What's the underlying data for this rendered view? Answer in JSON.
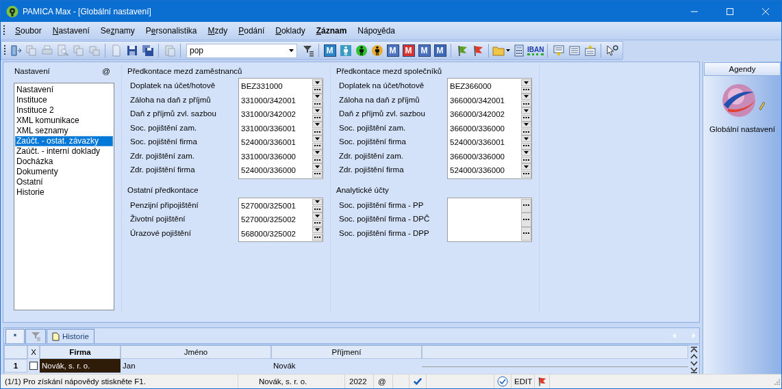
{
  "window": {
    "title": "PAMICA Max - [Globální nastavení]"
  },
  "menu": [
    {
      "key": "S",
      "post": "oubor",
      "active": false
    },
    {
      "key": "N",
      "post": "astavení",
      "active": false
    },
    {
      "pre": "Se",
      "key": "z",
      "post": "namy",
      "active": false
    },
    {
      "pre": "P",
      "key": "e",
      "post": "rsonalistika",
      "active": false
    },
    {
      "key": "M",
      "post": "zdy",
      "active": false
    },
    {
      "key": "P",
      "post": "odání",
      "active": false
    },
    {
      "key": "D",
      "post": "oklady",
      "active": false
    },
    {
      "key": "Z",
      "post": "áznam",
      "active": true
    },
    {
      "pre": "Nápo",
      "key": "v",
      "post": "ěda",
      "active": false
    }
  ],
  "toolbar": {
    "groups": [
      [
        {
          "kind": "door",
          "disabled": false
        },
        {
          "kind": "pages",
          "disabled": true
        },
        {
          "kind": "printer",
          "disabled": true
        },
        {
          "kind": "preview",
          "disabled": true
        },
        {
          "kind": "pages",
          "disabled": true
        },
        {
          "kind": "stack",
          "disabled": true
        }
      ],
      [
        {
          "kind": "page",
          "disabled": true
        },
        {
          "kind": "floppy",
          "disabled": false
        },
        {
          "kind": "floppies",
          "disabled": false
        }
      ],
      [
        {
          "kind": "clipboard",
          "disabled": true
        }
      ],
      [
        {
          "kind": "combo",
          "value": "pop",
          "disabled": false
        },
        {
          "kind": "filter",
          "disabled": false
        }
      ],
      [
        {
          "kind": "tile",
          "text": "M",
          "color": "#2a86c8",
          "disabled": false
        },
        {
          "kind": "person-tile",
          "color": "#3a9cc4",
          "disabled": false
        },
        {
          "kind": "person-circle",
          "color": "#2fc22f",
          "disabled": false
        },
        {
          "kind": "person-circle",
          "color": "#e8ac2c",
          "disabled": false
        },
        {
          "kind": "tile",
          "text": "M",
          "color": "#4e76c2",
          "disabled": false
        },
        {
          "kind": "tile",
          "text": "M",
          "color": "#d83434",
          "disabled": false
        },
        {
          "kind": "tile",
          "text": "M",
          "color": "#4a72c0",
          "disabled": false
        },
        {
          "kind": "tile",
          "text": "M",
          "color": "#3e68b8",
          "disabled": false
        }
      ],
      [
        {
          "kind": "flag",
          "color": "#5e9e22",
          "disabled": false
        },
        {
          "kind": "flag",
          "color": "#e03a28",
          "disabled": false
        }
      ],
      [
        {
          "kind": "folder",
          "disabled": false
        },
        {
          "kind": "calculator",
          "disabled": false
        },
        {
          "kind": "iban",
          "text": "IBAN",
          "disabled": false
        }
      ],
      [
        {
          "kind": "list-down",
          "disabled": false
        },
        {
          "kind": "list",
          "disabled": false
        },
        {
          "kind": "list-up",
          "disabled": false
        }
      ],
      [
        {
          "kind": "help",
          "disabled": false
        }
      ]
    ]
  },
  "settings": {
    "title": "Nastavení",
    "at": "@",
    "items": [
      {
        "label": "Nastavení",
        "selected": false
      },
      {
        "label": "Instituce",
        "selected": false
      },
      {
        "label": "Instituce 2",
        "selected": false
      },
      {
        "label": "XML komunikace",
        "selected": false
      },
      {
        "label": "XML seznamy",
        "selected": false
      },
      {
        "label": "Zaúčt. - ostat. závazky",
        "selected": true
      },
      {
        "label": "Zaúčt. - interní doklady",
        "selected": false
      },
      {
        "label": "Docházka",
        "selected": false
      },
      {
        "label": "Dokumenty",
        "selected": false
      },
      {
        "label": "Ostatní",
        "selected": false
      },
      {
        "label": "Historie",
        "selected": false
      }
    ]
  },
  "columns": [
    [
      {
        "title": "Předkontace mezd zaměstnanců",
        "rows": [
          {
            "label": "Doplatek na účet/hotově",
            "value": "BEZ331000",
            "kind": "combo"
          },
          {
            "label": "Záloha na daň z příjmů",
            "value": "331000/342001",
            "kind": "combo"
          },
          {
            "label": "Daň z příjmů zvl. sazbou",
            "value": "331000/342002",
            "kind": "combo"
          },
          {
            "label": "Soc. pojištění zam.",
            "value": "331000/336001",
            "kind": "combo"
          },
          {
            "label": "Soc. pojištění firma",
            "value": "524000/336001",
            "kind": "combo"
          },
          {
            "label": "Zdr. pojištění zam.",
            "value": "331000/336000",
            "kind": "combo"
          },
          {
            "label": "Zdr. pojištění firma",
            "value": "524000/336000",
            "kind": "combo"
          }
        ]
      },
      {
        "title": "Ostatní předkontace",
        "rows": [
          {
            "label": "Penzijní připojištění",
            "value": "527000/325001",
            "kind": "combo"
          },
          {
            "label": "Životní pojištění",
            "value": "527000/325002",
            "kind": "combo"
          },
          {
            "label": "Úrazové pojištění",
            "value": "568000/325002",
            "kind": "combo"
          }
        ]
      }
    ],
    [
      {
        "title": "Předkontace mezd společníků",
        "rows": [
          {
            "label": "Doplatek na účet/hotově",
            "value": "BEZ366000",
            "kind": "combo"
          },
          {
            "label": "Záloha na daň z příjmů",
            "value": "366000/342001",
            "kind": "combo"
          },
          {
            "label": "Daň z příjmů zvl. sazbou",
            "value": "366000/342002",
            "kind": "combo"
          },
          {
            "label": "Soc. pojištění zam.",
            "value": "366000/336000",
            "kind": "combo"
          },
          {
            "label": "Soc. pojištění firma",
            "value": "524000/336001",
            "kind": "combo"
          },
          {
            "label": "Zdr. pojištění zam.",
            "value": "366000/336000",
            "kind": "combo"
          },
          {
            "label": "Zdr. pojištění firma",
            "value": "524000/336000",
            "kind": "combo"
          }
        ]
      },
      {
        "title": "Analytické účty",
        "rows": [
          {
            "label": "Soc. pojištění firma - PP",
            "kind": "picker"
          },
          {
            "label": "Soc. pojištění firma - DPČ",
            "kind": "picker"
          },
          {
            "label": "Soc. pojištění firma - DPP",
            "kind": "picker"
          }
        ]
      }
    ]
  ],
  "agendas": {
    "header": "Agendy",
    "item": "Globální nastavení"
  },
  "bottom_tabs": [
    {
      "kind": "text",
      "label": "*",
      "selected": true
    },
    {
      "kind": "filter",
      "selected": false
    },
    {
      "kind": "doc",
      "label": "Historie",
      "selected": false
    }
  ],
  "grid": {
    "columns": [
      {
        "label": "X",
        "selected": false
      },
      {
        "label": "Firma",
        "selected": true
      },
      {
        "label": "Jméno",
        "selected": false
      },
      {
        "label": "Příjmení",
        "selected": false
      }
    ],
    "rows": [
      {
        "number": "1",
        "cells": [
          {
            "kind": "checkbox",
            "checked": false,
            "selected": false
          },
          {
            "kind": "text",
            "text": "Novák, s. r. o.",
            "selected": true
          },
          {
            "kind": "text",
            "text": "Jan",
            "selected": false
          },
          {
            "kind": "text",
            "text": "Novák",
            "selected": false
          }
        ]
      }
    ]
  },
  "status_bar": {
    "message": "(1/1) Pro získání nápovědy stiskněte F1.",
    "company": "Novák, s. r. o.",
    "year": "2022",
    "at": "@",
    "mode": "EDIT"
  }
}
